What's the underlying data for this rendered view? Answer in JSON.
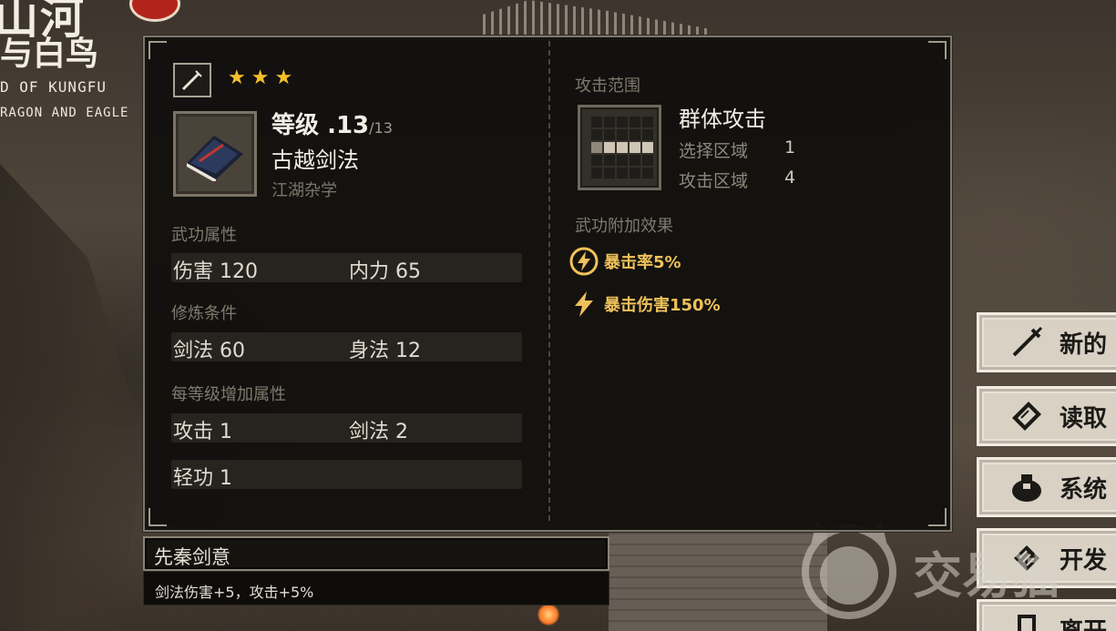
{
  "game": {
    "logo_title": "山河",
    "logo_subtitle": "与白鸟",
    "logo_en_line1": "D OF KUNGFU",
    "logo_en_line2": "RAGON AND EAGLE"
  },
  "skill": {
    "type_icon": "sword-icon",
    "stars": 3,
    "level_label": "等级",
    "level_value": ".13",
    "level_max": "/13",
    "name": "古越剑法",
    "school": "江湖杂学",
    "book_icon": "manual-book-icon"
  },
  "attributes": {
    "title": "武功属性",
    "items": [
      {
        "label": "伤害",
        "value": "120"
      },
      {
        "label": "内力",
        "value": "65"
      }
    ]
  },
  "requirements": {
    "title": "修炼条件",
    "items": [
      {
        "label": "剑法",
        "value": "60"
      },
      {
        "label": "身法",
        "value": "12"
      }
    ]
  },
  "per_level": {
    "title": "每等级增加属性",
    "items": [
      {
        "label": "攻击",
        "value": "1"
      },
      {
        "label": "剑法",
        "value": "2"
      },
      {
        "label": "轻功",
        "value": "1"
      }
    ]
  },
  "attack_range": {
    "title": "攻击范围",
    "type": "群体攻击",
    "select_label": "选择区域",
    "select_value": "1",
    "attack_label": "攻击区域",
    "attack_value": "4"
  },
  "effects": {
    "title": "武功附加效果",
    "items": [
      {
        "icon": "lightning-circle-icon",
        "text": "暴击率5%"
      },
      {
        "icon": "lightning-icon",
        "text": "暴击伤害150%"
      }
    ],
    "color": "#efc15a"
  },
  "passive": {
    "title": "先秦剑意",
    "description": "剑法伤害+5，攻击+5%"
  },
  "menu": {
    "items": [
      {
        "icon": "sword-icon",
        "label": "新的"
      },
      {
        "icon": "book-icon",
        "label": "读取"
      },
      {
        "icon": "backpack-icon",
        "label": "系统"
      },
      {
        "icon": "scroll-icon",
        "label": "开发"
      },
      {
        "icon": "door-icon",
        "label": "离开"
      }
    ]
  },
  "watermark": {
    "text": "交易猫"
  },
  "colors": {
    "star": "#f4c02d",
    "panel_bg": "#100f0d",
    "menu_bg": "#d8d1c4"
  }
}
